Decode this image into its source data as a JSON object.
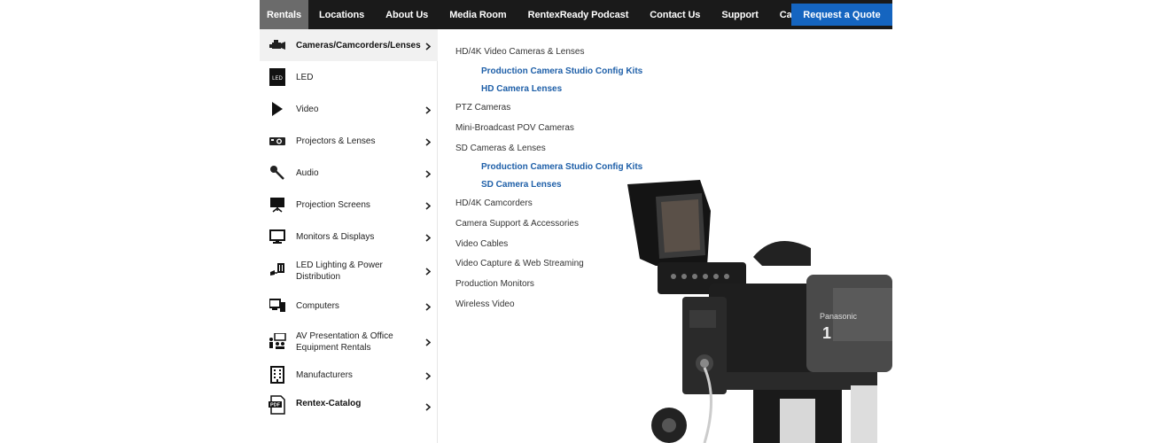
{
  "nav": {
    "items": [
      "Rentals",
      "Locations",
      "About Us",
      "Media Room",
      "RentexReady Podcast",
      "Contact Us",
      "Support",
      "Careers"
    ],
    "quote_label": "Request a Quote"
  },
  "sidebar": {
    "items": [
      {
        "label": "Cameras/Camcorders/Lenses",
        "icon": "camcorder-icon",
        "chevron": true
      },
      {
        "label": "LED",
        "icon": "led-panel-icon",
        "chevron": false
      },
      {
        "label": "Video",
        "icon": "play-icon",
        "chevron": true
      },
      {
        "label": "Projectors & Lenses",
        "icon": "projector-icon",
        "chevron": true
      },
      {
        "label": "Audio",
        "icon": "microphone-icon",
        "chevron": true
      },
      {
        "label": "Projection Screens",
        "icon": "projection-screen-icon",
        "chevron": true
      },
      {
        "label": "Monitors & Displays",
        "icon": "monitor-icon",
        "chevron": true
      },
      {
        "label": "LED Lighting & Power Distribution",
        "icon": "light-power-icon",
        "chevron": true
      },
      {
        "label": "Computers",
        "icon": "computer-icon",
        "chevron": true
      },
      {
        "label": "AV Presentation & Office Equipment Rentals",
        "icon": "presentation-icon",
        "chevron": true
      },
      {
        "label": "Manufacturers",
        "icon": "building-icon",
        "chevron": true
      },
      {
        "label": "Rentex-Catalog",
        "icon": "pdf-icon",
        "chevron": true
      }
    ]
  },
  "submenu": {
    "items": [
      {
        "label": "HD/4K Video Cameras & Lenses",
        "child": false
      },
      {
        "label": "Production Camera Studio Config Kits",
        "child": true
      },
      {
        "label": "HD Camera Lenses",
        "child": true
      },
      {
        "label": "PTZ Cameras",
        "child": false
      },
      {
        "label": "Mini-Broadcast POV Cameras",
        "child": false
      },
      {
        "label": "SD Cameras & Lenses",
        "child": false
      },
      {
        "label": "Production Camera Studio Config Kits",
        "child": true
      },
      {
        "label": "SD Camera Lenses",
        "child": true
      },
      {
        "label": "HD/4K Camcorders",
        "child": false
      },
      {
        "label": "Camera Support & Accessories",
        "child": false
      },
      {
        "label": "Video Cables",
        "child": false
      },
      {
        "label": "Video Capture & Web Streaming",
        "child": false
      },
      {
        "label": "Production Monitors",
        "child": false
      },
      {
        "label": "Wireless Video",
        "child": false
      }
    ]
  },
  "camera": {
    "brand_text": "Panasonic",
    "number_text": "1"
  },
  "colors": {
    "nav_bg": "#1a1a1a",
    "nav_active": "#6b6b6b",
    "quote_button": "#1565c0",
    "submenu_link": "#1e5fa8"
  }
}
